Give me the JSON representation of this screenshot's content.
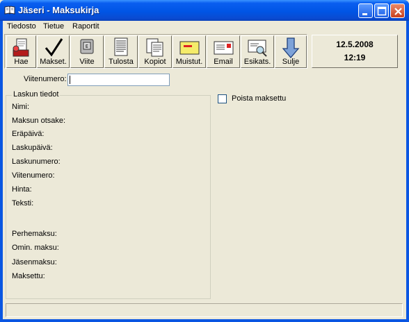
{
  "window": {
    "title": "Jäseri - Maksukirja",
    "colors": {
      "titlebar": "#0055e5",
      "face": "#ece9d8",
      "close": "#c9401e"
    }
  },
  "menu": [
    {
      "label": "Tiedosto"
    },
    {
      "label": "Tietue"
    },
    {
      "label": "Raportit"
    }
  ],
  "toolbar": {
    "hae": "Hae",
    "makset": "Makset.",
    "viite": "Viite",
    "tulosta": "Tulosta",
    "kopiot": "Kopiot",
    "muistut": "Muistut.",
    "email": "Email",
    "esikats": "Esikats.",
    "sulje": "Sulje"
  },
  "datetime": {
    "date": "12.5.2008",
    "time": "12:19"
  },
  "reference": {
    "label": "Viitenumero:",
    "value": ""
  },
  "invoice": {
    "legend": "Laskun tiedot",
    "fields": {
      "nimi": "Nimi:",
      "otsake": "Maksun otsake:",
      "erapaiva": "Eräpäivä:",
      "laskupaiva": "Laskupäivä:",
      "laskunumero": "Laskunumero:",
      "viitenumero": "Viitenumero:",
      "hinta": "Hinta:",
      "teksti": "Teksti:",
      "perhemaksu": "Perhemaksu:",
      "omin": "Omin. maksu:",
      "jasenmaksu": "Jäsenmaksu:",
      "maksettu": "Maksettu:"
    }
  },
  "options": {
    "remove_paid": "Poista maksettu"
  },
  "status": ""
}
